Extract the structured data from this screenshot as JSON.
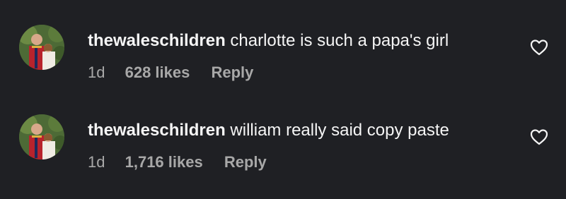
{
  "comments": [
    {
      "username": "thewaleschildren",
      "text": "charlotte is such a papa's girl",
      "time": "1d",
      "likes": "628 likes",
      "reply": "Reply",
      "avatar_icon": "profile-avatar-photo",
      "like_icon": "heart-outline-icon"
    },
    {
      "username": "thewaleschildren",
      "text": "william really said copy paste",
      "time": "1d",
      "likes": "1,716 likes",
      "reply": "Reply",
      "avatar_icon": "profile-avatar-photo",
      "like_icon": "heart-outline-icon"
    }
  ],
  "colors": {
    "background": "#1f2024",
    "primary_text": "#f5f5f5",
    "secondary_text": "#a8a8a8"
  }
}
